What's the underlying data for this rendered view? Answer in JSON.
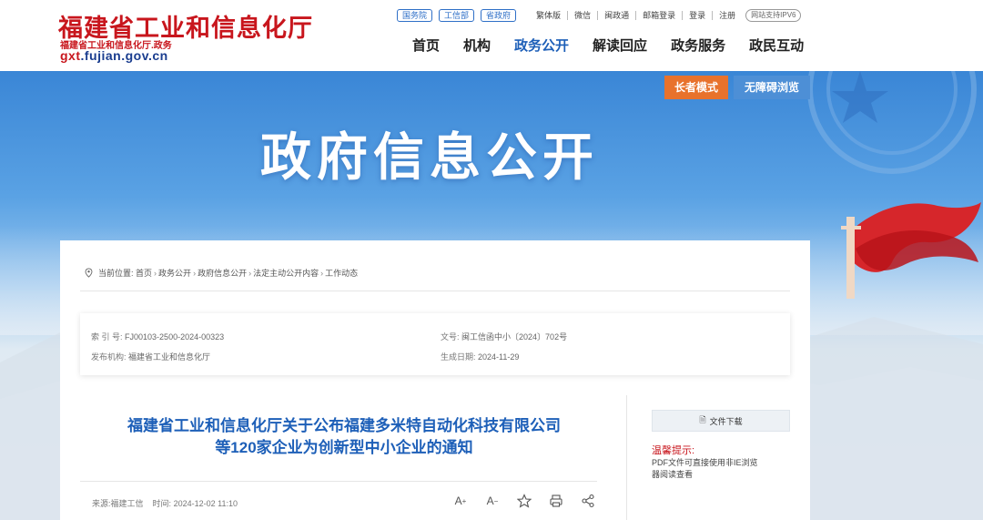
{
  "site": {
    "title": "福建省工业和信息化厅",
    "subtitle": "福建省工业和信息化厅.政务",
    "domain_prefix": "gxt",
    "domain_rest": ".fujian.gov.cn"
  },
  "top_links": {
    "pills": [
      "国务院",
      "工信部",
      "省政府"
    ],
    "utilities": [
      "繁体版",
      "微信",
      "闽政通",
      "邮箱登录",
      "登录",
      "注册"
    ],
    "ipv6": "网站支持IPV6"
  },
  "nav": {
    "items": [
      "首页",
      "机构",
      "政务公开",
      "解读回应",
      "政务服务",
      "政民互动"
    ],
    "active_index": 2
  },
  "banner": {
    "title": "政府信息公开",
    "elder_mode": "长者模式",
    "accessible": "无障碍浏览"
  },
  "breadcrumb": {
    "label": "当前位置:",
    "items": [
      "首页",
      "政务公开",
      "政府信息公开",
      "法定主动公开内容",
      "工作动态"
    ]
  },
  "meta": {
    "index_no_label": "索 引 号:",
    "index_no": "FJ00103-2500-2024-00323",
    "doc_no_label": "文号:",
    "doc_no": "闽工信函中小〔2024〕702号",
    "publisher_label": "发布机构:",
    "publisher": "福建省工业和信息化厅",
    "date_label": "生成日期:",
    "date": "2024-11-29"
  },
  "article": {
    "title_line1": "福建省工业和信息化厅关于公布福建多米特自动化科技有限公司",
    "title_line2": "等120家企业为创新型中小企业的通知",
    "source_label": "来源:",
    "source": "福建工信",
    "time_label": "时间:",
    "time": "2024-12-02 11:10"
  },
  "sidebar": {
    "download_label": "文件下载",
    "tip_title": "温馨提示:",
    "tip_text": "PDF文件可直接使用非IE浏览器阅读查看"
  },
  "colors": {
    "brand_red": "#c8161d",
    "brand_blue": "#1d5fb8",
    "elder_orange": "#e8722c"
  }
}
